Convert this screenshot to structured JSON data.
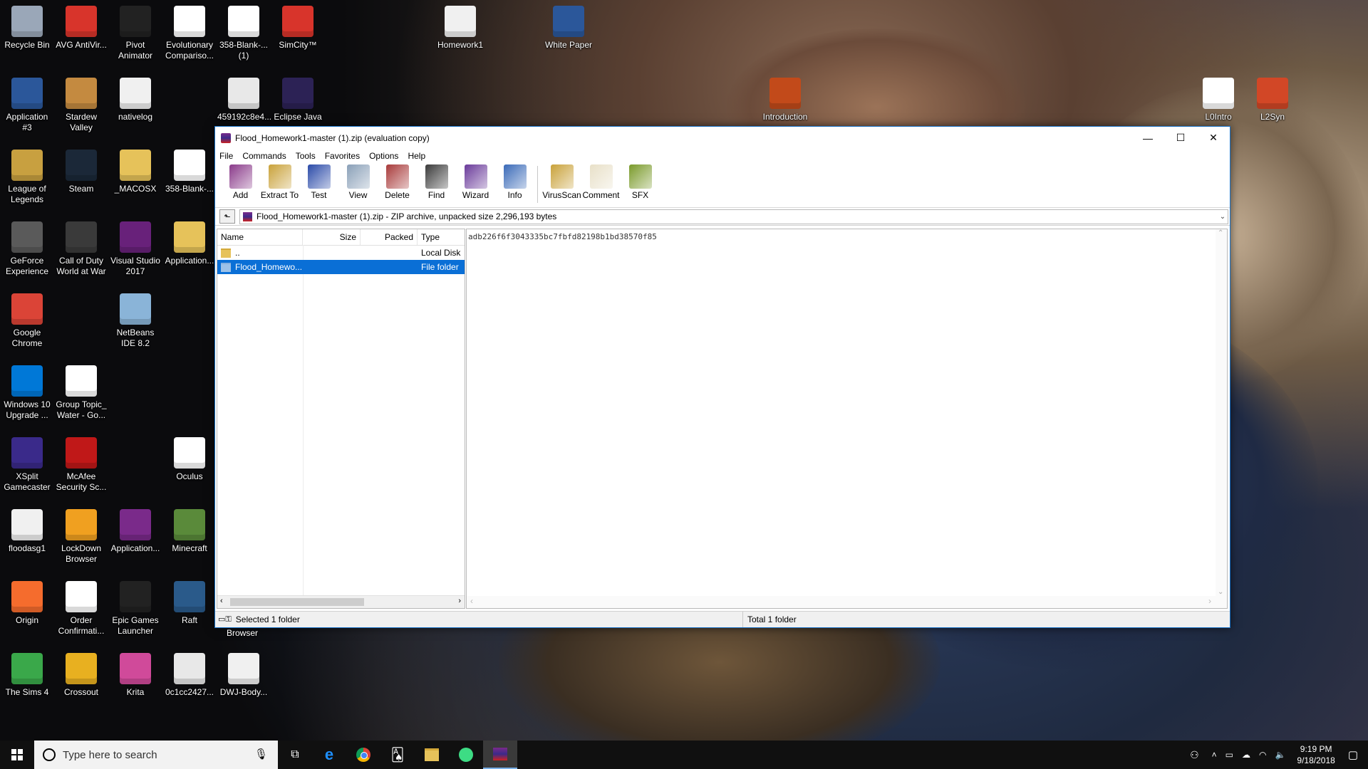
{
  "desktop": {
    "icons": [
      {
        "label": "Recycle Bin",
        "color": "#9aa7b8"
      },
      {
        "label": "AVG AntiVir...",
        "color": "#d8342b"
      },
      {
        "label": "Pivot Animator",
        "color": "#222222"
      },
      {
        "label": "Evolutionary Compariso...",
        "color": "#ffffff"
      },
      {
        "label": "358-Blank-... (1)",
        "color": "#ffffff"
      },
      {
        "label": "SimCity™",
        "color": "#d8342b"
      },
      {
        "label": "Homework1",
        "color": "#f0f0f0"
      },
      {
        "label": "White Paper",
        "color": "#2b579a"
      },
      {
        "label": "Application #3",
        "color": "#2b579a"
      },
      {
        "label": "Stardew Valley",
        "color": "#c48a40"
      },
      {
        "label": "nativelog",
        "color": "#f0f0f0"
      },
      {
        "label": "459192c8e4...",
        "color": "#e8e8e8"
      },
      {
        "label": "Eclipse Java",
        "color": "#2c2255"
      },
      {
        "label": "Introduction",
        "color": "#c24a1a"
      },
      {
        "label": "L0Intro",
        "color": "#ffffff"
      },
      {
        "label": "L2Syn",
        "color": "#d24726"
      },
      {
        "label": "League of Legends",
        "color": "#c8a040"
      },
      {
        "label": "Steam",
        "color": "#1b2838"
      },
      {
        "label": "_MACOSX",
        "color": "#e6c25a"
      },
      {
        "label": "358-Blank-...",
        "color": "#ffffff"
      },
      {
        "label": "GeForce Experience",
        "color": "#5a5a5a"
      },
      {
        "label": "Call of Duty World at War",
        "color": "#3a3a3a"
      },
      {
        "label": "Visual Studio 2017",
        "color": "#68217a"
      },
      {
        "label": "Application...",
        "color": "#e6c25a"
      },
      {
        "label": "Google Chrome",
        "color": "#db4437"
      },
      {
        "label": "NetBeans IDE 8.2",
        "color": "#8ab4d8"
      },
      {
        "label": "Windows 10 Upgrade ...",
        "color": "#0078d7"
      },
      {
        "label": "Group Topic_ Water - Go...",
        "color": "#ffffff"
      },
      {
        "label": "XSplit Gamecaster",
        "color": "#3a2a8a"
      },
      {
        "label": "McAfee Security Sc...",
        "color": "#c01818"
      },
      {
        "label": "Oculus",
        "color": "#ffffff"
      },
      {
        "label": "floodasg1",
        "color": "#f0f0f0"
      },
      {
        "label": "LockDown Browser",
        "color": "#f0a020"
      },
      {
        "label": "Application...",
        "color": "#7a2a8a"
      },
      {
        "label": "Minecraft",
        "color": "#5a8a3a"
      },
      {
        "label": "Origin",
        "color": "#f56c2d"
      },
      {
        "label": "Order Confirmati...",
        "color": "#ffffff"
      },
      {
        "label": "Epic Games Launcher",
        "color": "#222222"
      },
      {
        "label": "Raft",
        "color": "#2a5a8a"
      },
      {
        "label": "The Sims 4",
        "color": "#3aa84a"
      },
      {
        "label": "Crossout",
        "color": "#e8b020"
      },
      {
        "label": "Krita",
        "color": "#d04a9a"
      },
      {
        "label": "0c1cc2427...",
        "color": "#e8e8e8"
      },
      {
        "label": "DWJ-Body...",
        "color": "#f0f0f0"
      }
    ],
    "browser_fragment": "Browser"
  },
  "window": {
    "title": "Flood_Homework1-master (1).zip (evaluation copy)",
    "controls": {
      "minimize": "—",
      "maximize": "☐",
      "close": "✕"
    },
    "menu": [
      "File",
      "Commands",
      "Tools",
      "Favorites",
      "Options",
      "Help"
    ],
    "toolbar": [
      {
        "label": "Add",
        "icon": "add-archive-icon"
      },
      {
        "label": "Extract To",
        "icon": "extract-icon"
      },
      {
        "label": "Test",
        "icon": "test-icon"
      },
      {
        "label": "View",
        "icon": "view-icon"
      },
      {
        "label": "Delete",
        "icon": "delete-icon"
      },
      {
        "label": "Find",
        "icon": "find-icon"
      },
      {
        "label": "Wizard",
        "icon": "wizard-icon"
      },
      {
        "label": "Info",
        "icon": "info-icon"
      },
      {
        "label": "VirusScan",
        "icon": "virusscan-icon"
      },
      {
        "label": "Comment",
        "icon": "comment-icon"
      },
      {
        "label": "SFX",
        "icon": "sfx-icon"
      }
    ],
    "address": "Flood_Homework1-master (1).zip - ZIP archive, unpacked size 2,296,193 bytes",
    "columns": [
      "Name",
      "Size",
      "Packed",
      "Type"
    ],
    "rows": [
      {
        "name": "..",
        "type": "Local Disk",
        "selected": false
      },
      {
        "name": "Flood_Homewo...",
        "type": "File folder",
        "selected": true
      }
    ],
    "comment": "adb226f6f3043335bc7fbfd82198b1bd38570f85",
    "status_left": "Selected 1 folder",
    "status_right": "Total 1 folder"
  },
  "taskbar": {
    "search_placeholder": "Type here to search",
    "time": "9:19 PM",
    "date": "9/18/2018"
  }
}
